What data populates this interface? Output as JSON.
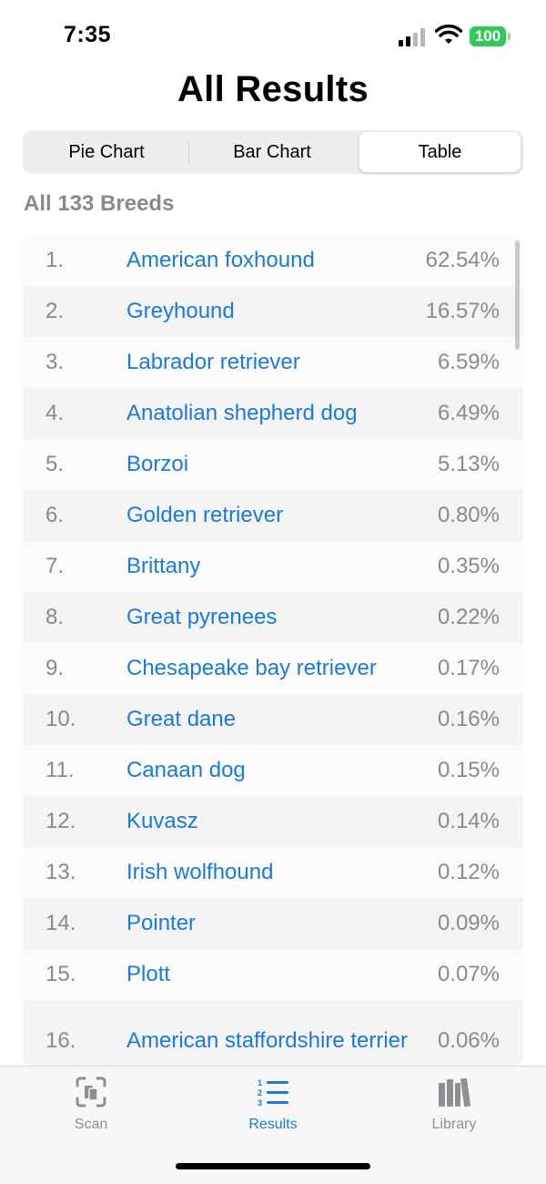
{
  "status_bar": {
    "time": "7:35",
    "battery": "100",
    "icons": [
      "cellular-signal-icon",
      "wifi-icon",
      "battery-icon"
    ]
  },
  "title": "All Results",
  "segmented_control": {
    "options": [
      "Pie Chart",
      "Bar Chart",
      "Table"
    ],
    "selected": "Table"
  },
  "section_label": "All 133 Breeds",
  "table": {
    "rows": [
      {
        "rank": "1.",
        "breed": "American foxhound",
        "percent": "62.54%"
      },
      {
        "rank": "2.",
        "breed": "Greyhound",
        "percent": "16.57%"
      },
      {
        "rank": "3.",
        "breed": "Labrador retriever",
        "percent": "6.59%"
      },
      {
        "rank": "4.",
        "breed": "Anatolian shepherd dog",
        "percent": "6.49%"
      },
      {
        "rank": "5.",
        "breed": "Borzoi",
        "percent": "5.13%"
      },
      {
        "rank": "6.",
        "breed": "Golden retriever",
        "percent": "0.80%"
      },
      {
        "rank": "7.",
        "breed": "Brittany",
        "percent": "0.35%"
      },
      {
        "rank": "8.",
        "breed": "Great pyrenees",
        "percent": "0.22%"
      },
      {
        "rank": "9.",
        "breed": "Chesapeake bay retriever",
        "percent": "0.17%"
      },
      {
        "rank": "10.",
        "breed": "Great dane",
        "percent": "0.16%"
      },
      {
        "rank": "11.",
        "breed": "Canaan dog",
        "percent": "0.15%"
      },
      {
        "rank": "12.",
        "breed": "Kuvasz",
        "percent": "0.14%"
      },
      {
        "rank": "13.",
        "breed": "Irish wolfhound",
        "percent": "0.12%"
      },
      {
        "rank": "14.",
        "breed": "Pointer",
        "percent": "0.09%"
      },
      {
        "rank": "15.",
        "breed": "Plott",
        "percent": "0.07%"
      },
      {
        "rank": "16.",
        "breed": "American staffordshire terrier",
        "percent": "0.06%"
      }
    ]
  },
  "tab_bar": {
    "tabs": [
      {
        "label": "Scan",
        "icon": "scan-icon"
      },
      {
        "label": "Results",
        "icon": "numbered-list-icon"
      },
      {
        "label": "Library",
        "icon": "books-icon"
      }
    ],
    "selected": "Results"
  },
  "colors": {
    "accent": "#1a7ad4",
    "secondary_text": "#8a8a8e",
    "battery": "#34c759",
    "row_alt": "#f4f4f5"
  }
}
